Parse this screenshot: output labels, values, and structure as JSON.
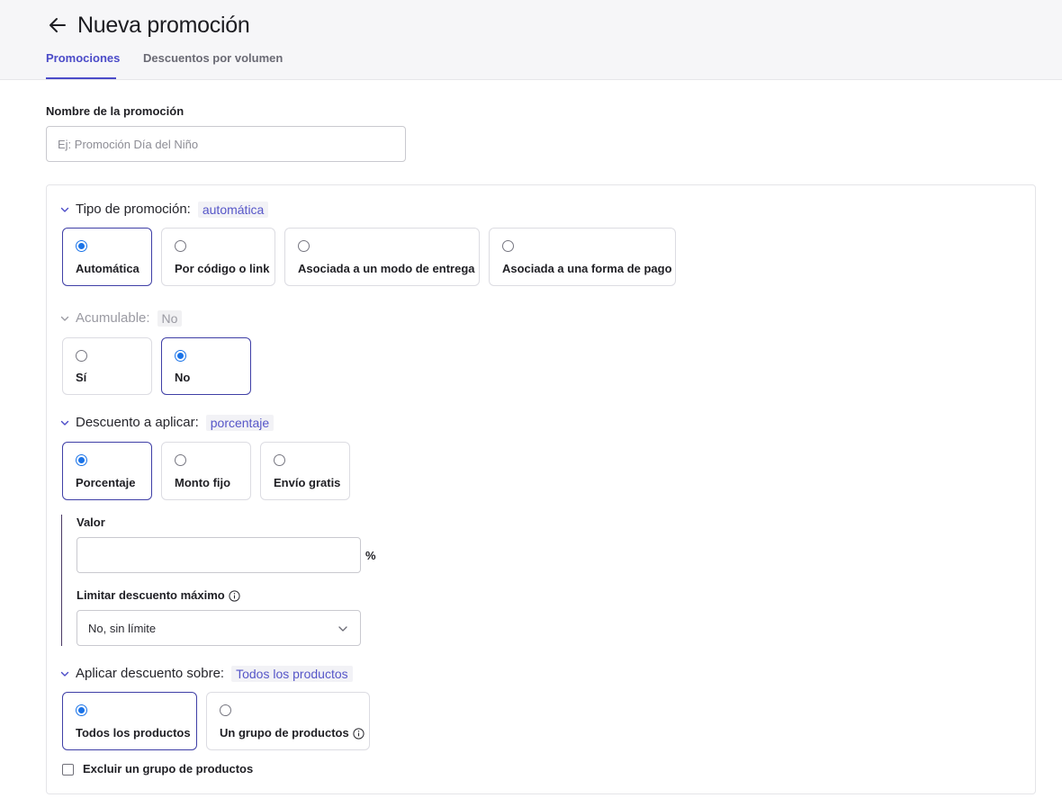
{
  "header": {
    "title": "Nueva promoción",
    "tabs": [
      {
        "label": "Promociones",
        "active": true
      },
      {
        "label": "Descuentos por volumen",
        "active": false
      }
    ]
  },
  "promo_name": {
    "label": "Nombre de la promoción",
    "placeholder": "Ej: Promoción Día del Niño",
    "value": ""
  },
  "promo_type": {
    "label": "Tipo de promoción:",
    "value": "automática",
    "options": [
      "Automática",
      "Por código o link",
      "Asociada a un modo de entrega",
      "Asociada a una forma de pago"
    ],
    "selected": "Automática"
  },
  "cumulative": {
    "label": "Acumulable:",
    "value": "No",
    "options": [
      "Sí",
      "No"
    ],
    "selected": "No"
  },
  "discount": {
    "label": "Descuento a aplicar:",
    "value": "porcentaje",
    "options": [
      "Porcentaje",
      "Monto fijo",
      "Envío gratis"
    ],
    "selected": "Porcentaje",
    "amount_label": "Valor",
    "amount_value": "",
    "amount_unit": "%",
    "max_label": "Limitar descuento máximo",
    "max_value": "No, sin límite"
  },
  "apply_on": {
    "label": "Aplicar descuento sobre:",
    "value": "Todos los productos",
    "options": [
      "Todos los productos",
      "Un grupo de productos"
    ],
    "selected": "Todos los productos",
    "exclude_label": "Excluir un grupo de productos",
    "exclude_checked": false
  },
  "icons": [
    "arrow-left-icon",
    "chevron-down-icon",
    "info-icon",
    "radio-icon",
    "checkbox-icon"
  ],
  "colors": {
    "accent": "#4b4bc8",
    "radio": "#1a73e8",
    "header_bg": "#f6f6f8"
  }
}
